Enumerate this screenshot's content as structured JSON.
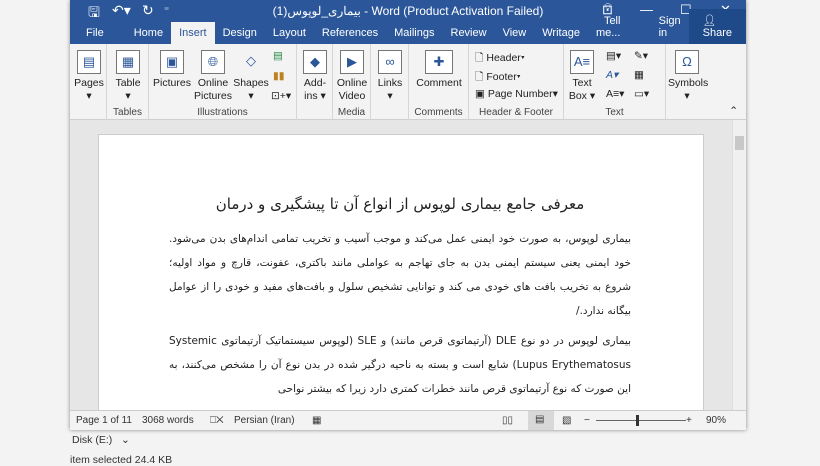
{
  "window": {
    "title": "بیماری_لوپوس(1) - Word (Product Activation Failed)"
  },
  "tabs": [
    "File",
    "Home",
    "Insert",
    "Design",
    "Layout",
    "References",
    "Mailings",
    "Review",
    "View",
    "Writage"
  ],
  "active_tab": "Insert",
  "tell_me": "Tell me...",
  "sign_in": "Sign in",
  "share": "Share",
  "ribbon": {
    "pages": "Pages",
    "table": "Table",
    "pictures": "Pictures",
    "online_pictures": "Online Pictures",
    "shapes": "Shapes",
    "addins": "Add-ins",
    "online_video": "Online Video",
    "links": "Links",
    "comment": "Comment",
    "header": "Header",
    "footer": "Footer",
    "page_number": "Page Number",
    "text_box": "Text Box",
    "symbols": "Symbols",
    "groups": {
      "tables": "Tables",
      "illustrations": "Illustrations",
      "media": "Media",
      "comments": "Comments",
      "header_footer": "Header & Footer",
      "text": "Text"
    }
  },
  "document": {
    "title": "معرفی جامع بیماری لوپوس از انواع آن تا پیشگیری و درمان",
    "p1": "بیماری لوپوس، به صورت خود ایمنی عمل می‌کند و موجب آسیب و تخریب تمامی اندام‌های بدن می‌شود. خود ایمنی یعنی سیستم ایمنی بدن به جای تهاجم به عواملی مانند باکتری، عفونت، قارچ و مواد اولیه؛ شروع به تخریب بافت های خودی می کند و توانایی تشخیص سلول و بافت‌های مفید و خودی را از عوامل بیگانه ندارد./",
    "p2": "بیماری لوپوس در دو نوع DLE (آرتیماتوی قرص مانند) و SLE (لوپوس سیستماتیک آرتیماتوی Systemic Lupus Erythematosus) شایع است و بسته به ناحیه درگیر شده در بدن نوع آن را مشخص می‌کنند، به این صورت که نوع آرتیماتوی قرص مانند خطرات کمتری دارد زیرا که بیشتر نواحی"
  },
  "status": {
    "page": "Page 1 of 11",
    "words": "3068 words",
    "language": "Persian (Iran)",
    "zoom": "90%",
    "zoom_percent": 90
  },
  "explorer": {
    "disk": "Disk (E:)",
    "selected": "item selected  24.4 KB"
  }
}
